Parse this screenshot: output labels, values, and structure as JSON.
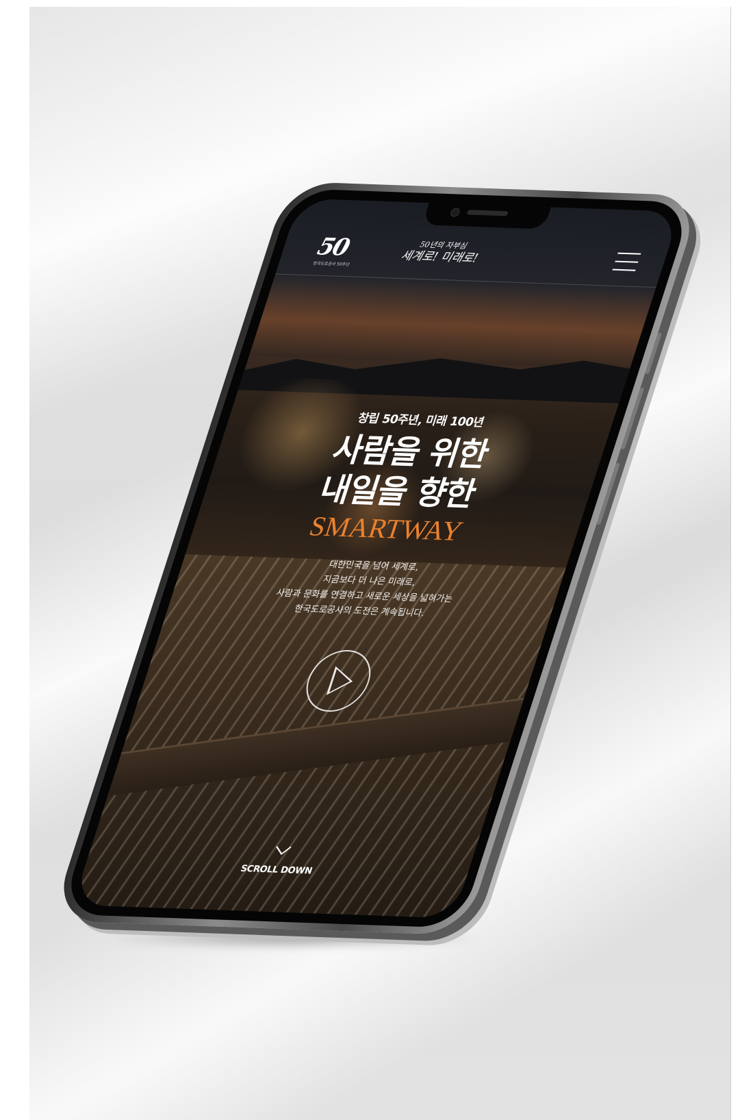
{
  "header": {
    "logo_mark": "50",
    "logo_subtitle": "한국도로공사 50주년",
    "slogan_small": "50년의 자부심",
    "slogan_big": "세계로! 미래로!",
    "menu_icon": "hamburger-icon"
  },
  "hero": {
    "kicker": "창립 50주년, 미래 100년",
    "headline_line1": "사람을 위한",
    "headline_line2": "내일을 향한",
    "brand": "SMARTWAY",
    "body_line1": "대한민국을 넘어 세계로,",
    "body_line2": "지금보다 더 나은 미래로,",
    "body_line3": "사람과 문화를 연결하고 새로운 세상을 넓혀가는",
    "body_line4": "한국도로공사의 도전은 계속됩니다."
  },
  "controls": {
    "play_icon": "play-icon",
    "scroll_label": "SCROLL DOWN",
    "scroll_icon": "chevron-down-icon"
  },
  "colors": {
    "accent": "#e9812f",
    "text": "#ffffff"
  }
}
